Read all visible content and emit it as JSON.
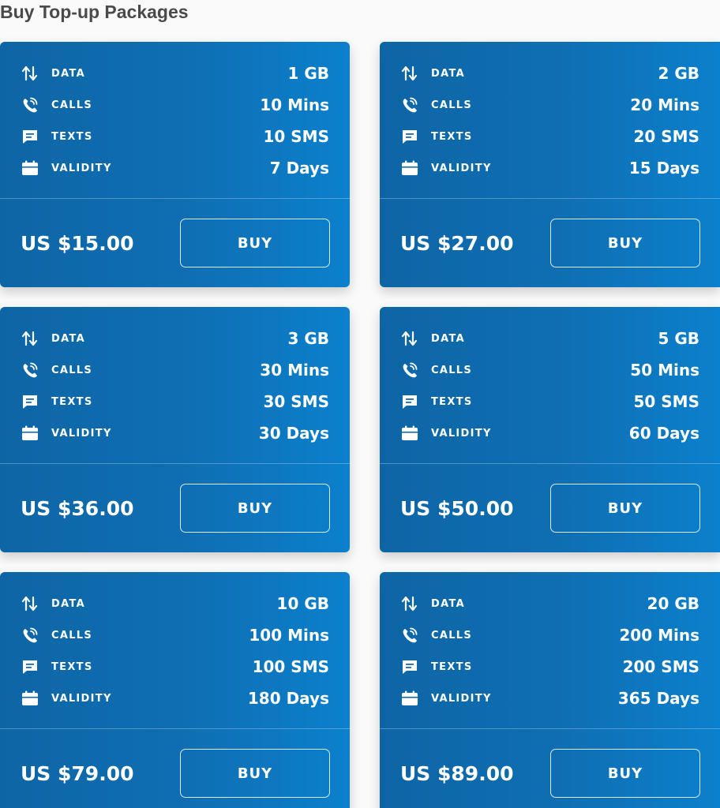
{
  "page": {
    "title": "Buy Top-up Packages"
  },
  "labels": {
    "data": "DATA",
    "calls": "CALLS",
    "texts": "TEXTS",
    "validity": "VALIDITY",
    "buy": "BUY"
  },
  "icons": {
    "data": "arrows-up-down-icon",
    "calls": "phone-ringing-icon",
    "texts": "chat-bubble-icon",
    "validity": "calendar-icon"
  },
  "colors": {
    "card_gradient_start": "#0d65a5",
    "card_gradient_end": "#0b80cd",
    "title_text": "#4a4a4a",
    "background": "#fafafa"
  },
  "packages": [
    {
      "data": "1 GB",
      "calls": "10 Mins",
      "texts": "10 SMS",
      "validity": "7 Days",
      "price": "US $15.00"
    },
    {
      "data": "2 GB",
      "calls": "20 Mins",
      "texts": "20 SMS",
      "validity": "15 Days",
      "price": "US $27.00"
    },
    {
      "data": "3 GB",
      "calls": "30 Mins",
      "texts": "30 SMS",
      "validity": "30 Days",
      "price": "US $36.00"
    },
    {
      "data": "5 GB",
      "calls": "50 Mins",
      "texts": "50 SMS",
      "validity": "60 Days",
      "price": "US $50.00"
    },
    {
      "data": "10 GB",
      "calls": "100 Mins",
      "texts": "100 SMS",
      "validity": "180 Days",
      "price": "US $79.00"
    },
    {
      "data": "20 GB",
      "calls": "200 Mins",
      "texts": "200 SMS",
      "validity": "365 Days",
      "price": "US $89.00"
    }
  ]
}
